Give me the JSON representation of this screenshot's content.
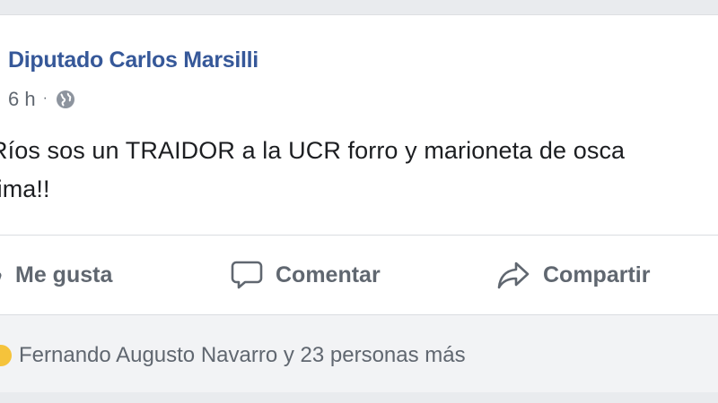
{
  "post": {
    "author": "Diputado Carlos Marsilli",
    "time": "6 h",
    "separator": "·",
    "privacy_icon": "globe-icon",
    "text_lines": [
      "Ríos sos un TRAIDOR a la UCR forro y marioneta de osca",
      "tima!!"
    ]
  },
  "actions": {
    "like_label": "Me gusta",
    "like_icon": "thumbs-up-icon",
    "comment_label": "Comentar",
    "comment_icon": "speech-bubble-icon",
    "share_label": "Compartir",
    "share_icon": "share-arrow-icon"
  },
  "reactions": {
    "icon": "reaction-emoji-icon",
    "text": "Fernando Augusto Navarro y 23 personas más"
  },
  "colors": {
    "author_link": "#365899",
    "secondary_text": "#606770",
    "body_text": "#1c1e21",
    "page_background": "#e9ebee",
    "reactions_background": "#f2f3f5"
  }
}
